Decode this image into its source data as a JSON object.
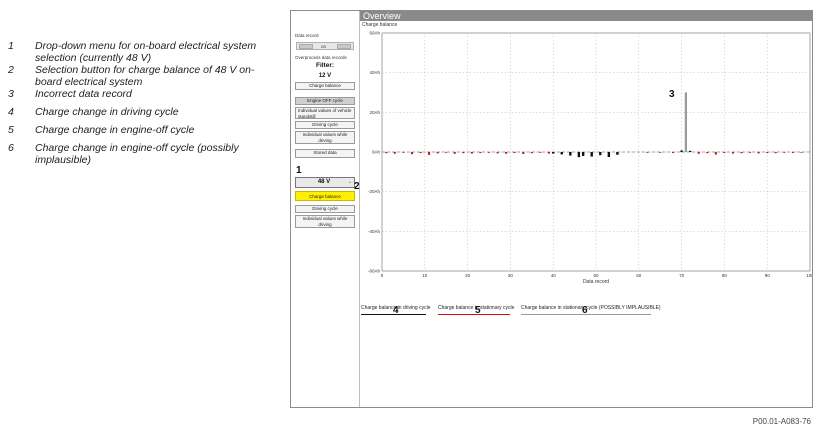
{
  "legend_items": [
    {
      "num": "1",
      "text": "Drop-down menu for on-board electrical system selection (currently 48 V)"
    },
    {
      "num": "2",
      "text": "Selection button for charge balance of 48 V on-board electrical system"
    },
    {
      "num": "3",
      "text": "Incorrect data record"
    },
    {
      "num": "4",
      "text": "Charge change in driving cycle"
    },
    {
      "num": "5",
      "text": "Charge change in engine-off cycle"
    },
    {
      "num": "6",
      "text": "Charge change in engine-off cycle (possibly implausible)"
    }
  ],
  "window": {
    "title": "Overview",
    "subtitle": "Charge balance"
  },
  "sidebar": {
    "data_record_label": "Data record",
    "nav_of": "on",
    "overprocess_label": "Overprocess data records",
    "filter_label": "Filter:",
    "voltage_12": "12 V",
    "btn_charge_balance_12": "Charge balance",
    "btn_engine_off_cycle": "Engine OFF cycle",
    "btn_individual_vehicle": "Individual values of vehicle standstill",
    "btn_driving_cycle_12": "Driving cycle",
    "btn_individual_driving_12": "Individual values while driving",
    "btn_stored_data": "Stored data",
    "dropdown_value": "48 V",
    "btn_charge_balance_48": "Charge balance",
    "btn_driving_cycle_48": "Driving cycle",
    "btn_individual_driving_48": "Individual values while driving"
  },
  "annotations": {
    "a1": "1",
    "a2": "2",
    "a3": "3",
    "a4": "4",
    "a5": "5",
    "a6": "6"
  },
  "chart_legend": [
    {
      "label": "Charge balance in driving cycle",
      "color": "#111111"
    },
    {
      "label": "Charge balance in stationary cycle",
      "color": "#d01010"
    },
    {
      "label": "Charge balance in stationary cycle (POSSIBLY IMPLAUSIBLE)",
      "color": "#999999"
    }
  ],
  "footer_code": "P00.01-A083-76",
  "chart_data": {
    "type": "bar",
    "xlabel": "Data record",
    "ylabel": "",
    "xlim": [
      0,
      100
    ],
    "ylim": [
      -60,
      60
    ],
    "xticks": [
      0,
      10,
      20,
      30,
      40,
      50,
      60,
      70,
      80,
      90,
      100
    ],
    "yticks": [
      {
        "value": 60,
        "label": "60Ah"
      },
      {
        "value": 40,
        "label": "40Ah"
      },
      {
        "value": 20,
        "label": "20Ah"
      },
      {
        "value": 0,
        "label": "0Ah"
      },
      {
        "value": -20,
        "label": "-20Ah"
      },
      {
        "value": -40,
        "label": "-40Ah"
      },
      {
        "value": -60,
        "label": "-60Ah"
      }
    ],
    "series": [
      {
        "name": "Charge balance in driving cycle",
        "color": "#111111",
        "x": [
          40,
          42,
          44,
          46,
          47,
          49,
          51,
          53,
          55,
          70,
          72
        ],
        "values": [
          -0.8,
          -1.2,
          -1.8,
          -2.6,
          -2.0,
          -2.3,
          -1.6,
          -2.5,
          -1.4,
          0.8,
          0.6
        ]
      },
      {
        "name": "Charge balance in stationary cycle",
        "color": "#d01010",
        "x": [
          1,
          3,
          5,
          7,
          9,
          11,
          13,
          15,
          17,
          19,
          21,
          23,
          25,
          27,
          29,
          31,
          33,
          35,
          37,
          39,
          62,
          65,
          68,
          74,
          76,
          78,
          80,
          82,
          84,
          86,
          88,
          90,
          92,
          94,
          96,
          98
        ],
        "values": [
          -0.6,
          -0.9,
          -0.4,
          -1.1,
          -0.5,
          -1.5,
          -0.7,
          -0.4,
          -0.9,
          -0.6,
          -0.8,
          -0.5,
          -0.4,
          -0.7,
          -0.9,
          -0.5,
          -1.0,
          -0.6,
          -0.4,
          -0.8,
          -0.4,
          -0.3,
          -0.5,
          -0.9,
          -0.6,
          -1.3,
          -0.5,
          -0.8,
          -0.6,
          -0.4,
          -0.7,
          -0.5,
          -0.6,
          -0.4,
          -0.5,
          -0.3
        ]
      },
      {
        "name": "Charge balance in stationary cycle (POSSIBLY IMPLAUSIBLE)",
        "color": "#999999",
        "x": [
          71
        ],
        "values": [
          30
        ]
      }
    ]
  }
}
